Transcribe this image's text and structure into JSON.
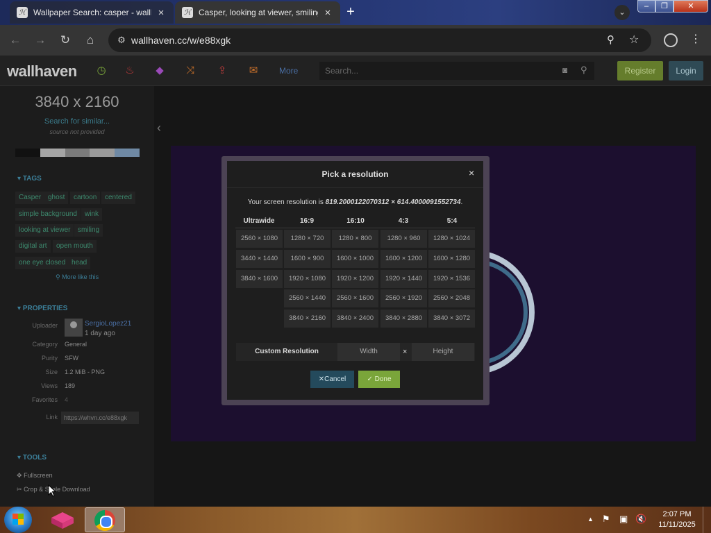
{
  "browser": {
    "tabs": [
      {
        "title": "Wallpaper Search: casper - wallhaven",
        "active": false
      },
      {
        "title": "Casper, looking at viewer, smiling",
        "active": true
      }
    ],
    "favicon_letter": "ℋ",
    "new_tab": "+",
    "url": "wallhaven.cc/w/e88xgk"
  },
  "site": {
    "logo": "wallhaven",
    "more_label": "More",
    "search_placeholder": "Search...",
    "register_label": "Register",
    "login_label": "Login",
    "nav_icons": [
      "clock-icon",
      "fire-icon",
      "gem-icon",
      "shuffle-icon",
      "upload-icon",
      "chat-icon"
    ],
    "colors": {
      "register": "#657d2c",
      "login": "#2f4a55",
      "accent": "#3c7f99"
    }
  },
  "sidebar": {
    "resolution": "3840 x 2160",
    "search_similar": "Search for similar...",
    "source": "source not provided",
    "palette": [
      "#111111",
      "#a5a5a5",
      "#7b7b7b",
      "#9a9a9a",
      "#6f89a4"
    ],
    "tags_header": "TAGS",
    "tags": [
      "Casper",
      "ghost",
      "cartoon",
      "centered",
      "simple background",
      "wink",
      "looking at viewer",
      "smiling",
      "digital art",
      "open mouth",
      "one eye closed",
      "head"
    ],
    "more_like_this": "More like this",
    "properties_header": "PROPERTIES",
    "properties": {
      "uploader_label": "Uploader",
      "uploader_name": "SergioLopez21",
      "uploader_time": "1 day ago",
      "category_label": "Category",
      "category": "General",
      "purity_label": "Purity",
      "purity": "SFW",
      "size_label": "Size",
      "size": "1.2 MiB - PNG",
      "views_label": "Views",
      "views": "189",
      "favorites_label": "Favorites",
      "favorites": "4",
      "link_label": "Link",
      "link": "https://whvn.cc/e88xgk"
    },
    "tools_header": "TOOLS",
    "tools": [
      "Fullscreen",
      "Crop & Scale Download"
    ]
  },
  "modal": {
    "title": "Pick a resolution",
    "close": "×",
    "screen_res_prefix": "Your screen resolution is ",
    "screen_res_value": "819.2000122070312 × 614.4000091552734",
    "screen_res_suffix": ".",
    "columns": [
      {
        "header": "Ultrawide",
        "items": [
          "2560 × 1080",
          "3440 × 1440",
          "3840 × 1600"
        ]
      },
      {
        "header": "16:9",
        "items": [
          "1280 × 720",
          "1600 × 900",
          "1920 × 1080",
          "2560 × 1440",
          "3840 × 2160"
        ]
      },
      {
        "header": "16:10",
        "items": [
          "1280 × 800",
          "1600 × 1000",
          "1920 × 1200",
          "2560 × 1600",
          "3840 × 2400"
        ]
      },
      {
        "header": "4:3",
        "items": [
          "1280 × 960",
          "1600 × 1200",
          "1920 × 1440",
          "2560 × 1920",
          "3840 × 2880"
        ]
      },
      {
        "header": "5:4",
        "items": [
          "1280 × 1024",
          "1600 × 1280",
          "1920 × 1536",
          "2560 × 2048",
          "3840 × 3072"
        ]
      }
    ],
    "custom_label": "Custom Resolution",
    "width_placeholder": "Width",
    "times": "×",
    "height_placeholder": "Height",
    "cancel_label": "Cancel",
    "done_label": "Done"
  },
  "taskbar": {
    "time": "2:07 PM",
    "date": "11/11/2025"
  }
}
